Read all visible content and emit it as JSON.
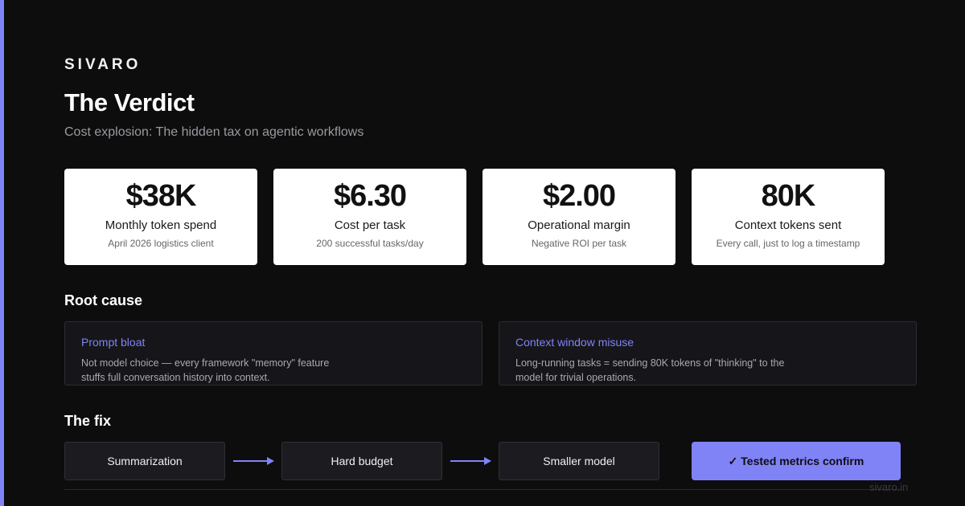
{
  "brand": "SIVARO",
  "title": "The Verdict",
  "subtitle": "Cost explosion: The hidden tax on agentic workflows",
  "metrics": [
    {
      "value": "$38K",
      "label": "Monthly token spend",
      "note": "April 2026 logistics client"
    },
    {
      "value": "$6.30",
      "label": "Cost per task",
      "note": "200 successful tasks/day"
    },
    {
      "value": "$2.00",
      "label": "Operational margin",
      "note": "Negative ROI per task"
    },
    {
      "value": "80K",
      "label": "Context tokens sent",
      "note": "Every call, just to log a timestamp"
    }
  ],
  "root_cause": {
    "heading": "Root cause",
    "cards": [
      {
        "title": "Prompt bloat",
        "desc": "Not model choice — every framework \"memory\" feature stuffs full conversation history into context."
      },
      {
        "title": "Context window misuse",
        "desc": "Long-running tasks = sending 80K tokens of \"thinking\" to the model for trivial operations."
      }
    ]
  },
  "fix": {
    "heading": "The fix",
    "steps": [
      "Summarization",
      "Hard budget",
      "Smaller model"
    ],
    "result": "✓ Tested metrics confirm"
  },
  "footer": {
    "url": "sivaro.in"
  },
  "colors": {
    "accent": "#8083f6",
    "background": "#0d0d0e",
    "card": "#ffffff"
  },
  "icons": {
    "arrow": "arrow-right-icon",
    "check": "check-icon"
  }
}
